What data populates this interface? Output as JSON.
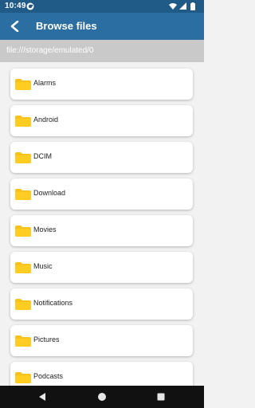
{
  "status_bar": {
    "time": "10:49",
    "notification_icon": "app-notification-icon",
    "wifi_icon": "wifi-icon",
    "signal_icon": "cell-signal-icon",
    "battery_icon": "battery-icon"
  },
  "app_bar": {
    "title": "Browse files",
    "back_icon": "back-arrow-icon",
    "color": "#2a6ea2"
  },
  "path_bar": {
    "path": "file:///storage/emulated/0"
  },
  "folders": [
    {
      "label": "Alarms",
      "icon": "folder-icon"
    },
    {
      "label": "Android",
      "icon": "folder-icon"
    },
    {
      "label": "DCIM",
      "icon": "folder-icon"
    },
    {
      "label": "Download",
      "icon": "folder-icon"
    },
    {
      "label": "Movies",
      "icon": "folder-icon"
    },
    {
      "label": "Music",
      "icon": "folder-icon"
    },
    {
      "label": "Notifications",
      "icon": "folder-icon"
    },
    {
      "label": "Pictures",
      "icon": "folder-icon"
    },
    {
      "label": "Podcasts",
      "icon": "folder-icon"
    }
  ],
  "nav_bar": {
    "back_icon": "nav-back-icon",
    "home_icon": "nav-home-icon",
    "recents_icon": "nav-recents-icon"
  }
}
